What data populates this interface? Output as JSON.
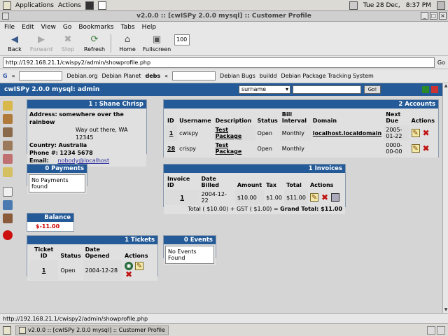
{
  "panel": {
    "applications": "Applications",
    "actions": "Actions",
    "clock_date": "Tue 28 Dec,",
    "clock_time": "8:37 PM"
  },
  "window": {
    "title": "v2.0.0 :: [cwISPy 2.0.0 mysql] :: Customer Profile"
  },
  "menu": [
    "File",
    "Edit",
    "View",
    "Go",
    "Bookmarks",
    "Tabs",
    "Help"
  ],
  "toolbar": {
    "back": "Back",
    "forward": "Forward",
    "stop": "Stop",
    "refresh": "Refresh",
    "home": "Home",
    "fullscreen": "Fullscreen",
    "zoom": "100"
  },
  "urlbar": {
    "url": "http://192.168.21.1/cwispy2/admin/showprofile.php",
    "go": "Go"
  },
  "bookmarks": {
    "google_letter": "G",
    "items": [
      "Debian.org",
      "Debian Planet",
      "debs",
      "Debian Bugs",
      "buildd",
      "Debian Package Tracking System"
    ]
  },
  "app": {
    "title": "cwISPy 2.0.0 mysql: admin",
    "search_select": "surname",
    "go_label": "Go!"
  },
  "customer": {
    "header": "1 : Shane Chrisp",
    "address_label": "Address:",
    "address_line1": "somewhere over the rainbow",
    "address_line2": "Way out there, WA 12345",
    "country_label": "Country:",
    "country": "Australia",
    "phone_label": "Phone #:",
    "phone": "1234 5678",
    "email_label": "Email:",
    "email": "nobody@localhost"
  },
  "payments": {
    "header": "0 Payments",
    "empty": "No Payments found"
  },
  "balance": {
    "header": "Balance",
    "value": "$-11.00"
  },
  "tickets": {
    "header": "1 Tickets",
    "cols": [
      "Ticket ID",
      "Status",
      "Date Opened",
      "Actions"
    ],
    "rows": [
      {
        "id": "1",
        "status": "Open",
        "date": "2004-12-28"
      }
    ]
  },
  "events": {
    "header": "0 Events",
    "empty": "No Events Found"
  },
  "accounts": {
    "header": "2 Accounts",
    "cols": [
      "ID",
      "Username",
      "Description",
      "Status",
      "Bill Interval",
      "Domain",
      "Next Due",
      "Actions"
    ],
    "rows": [
      {
        "id": "1",
        "username": "cwispy",
        "description": "Test Package",
        "status": "Open",
        "interval": "Monthly",
        "domain": "localhost.localdomain",
        "next_due": "2005-01-22"
      },
      {
        "id": "28",
        "username": "crispy",
        "description": "Test Package",
        "status": "Open",
        "interval": "Monthly",
        "domain": "",
        "next_due": "0000-00-00"
      }
    ]
  },
  "invoices": {
    "header": "1 Invoices",
    "cols": [
      "Invoice ID",
      "Date Billed",
      "Amount",
      "Tax",
      "Total",
      "Actions"
    ],
    "rows": [
      {
        "id": "1",
        "date": "2004-12-22",
        "amount": "$10.00",
        "tax": "$1.00",
        "total": "$11.00"
      }
    ],
    "summary": "Total ( $10.00) + GST ( $1.00) =",
    "grand": "Grand Total: $11.00"
  },
  "status": {
    "text": "http://192.168.21.1/cwispy2/admin/showprofile.php"
  },
  "taskbar": {
    "task": "v2.0.0 :: [cwISPy 2.0.0 mysql] :: Customer Profile"
  },
  "colors": {
    "header_blue": "#235a97",
    "balance_red": "#cc0000"
  }
}
